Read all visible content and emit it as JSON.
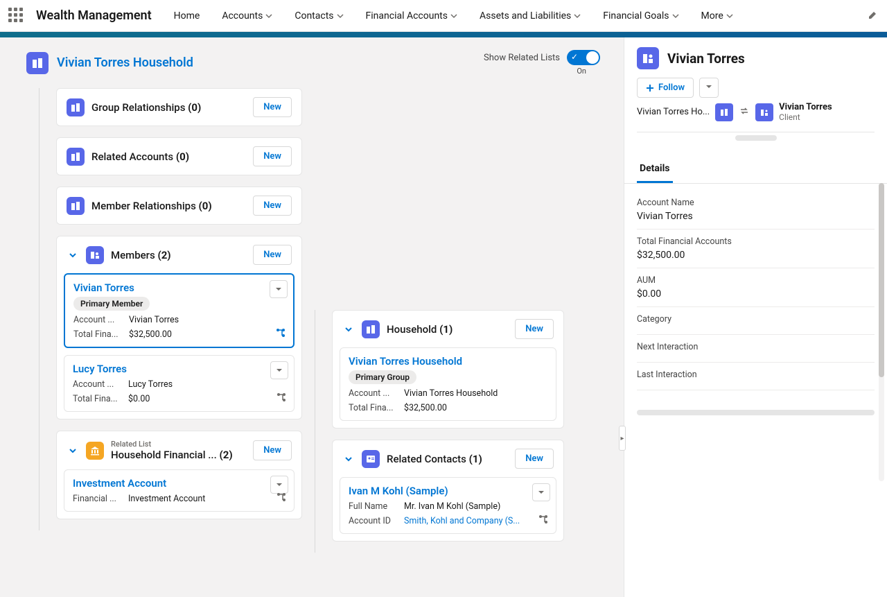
{
  "nav": {
    "appTitle": "Wealth Management",
    "items": [
      "Home",
      "Accounts",
      "Contacts",
      "Financial Accounts",
      "Assets and Liabilities",
      "Financial Goals",
      "More"
    ],
    "hasDropdown": [
      false,
      true,
      true,
      true,
      true,
      true,
      true
    ]
  },
  "page": {
    "title": "Vivian Torres Household",
    "toggleLabel": "Show Related Lists",
    "toggleState": "On"
  },
  "labels": {
    "new": "New",
    "follow": "Follow",
    "detailsTab": "Details"
  },
  "lists": {
    "groupRel": {
      "title": "Group Relationships",
      "count": "(0)"
    },
    "relAcc": {
      "title": "Related Accounts",
      "count": "(0)"
    },
    "memRel": {
      "title": "Member Relationships",
      "count": "(0)"
    },
    "members": {
      "title": "Members",
      "count": "(2)"
    },
    "hhFin": {
      "pretitle": "Related List",
      "title": "Household Financial ...",
      "count": "(2)"
    },
    "household": {
      "title": "Household",
      "count": "(1)"
    },
    "relCon": {
      "title": "Related Contacts",
      "count": "(1)"
    }
  },
  "members": [
    {
      "name": "Vivian Torres",
      "badge": "Primary Member",
      "fields": [
        {
          "k": "Account ...",
          "v": "Vivian Torres"
        },
        {
          "k": "Total Fina...",
          "v": "$32,500.00"
        }
      ],
      "selected": true,
      "shareColor": "blue"
    },
    {
      "name": "Lucy Torres",
      "fields": [
        {
          "k": "Account ...",
          "v": "Lucy Torres"
        },
        {
          "k": "Total Fina...",
          "v": "$0.00"
        }
      ],
      "selected": false,
      "shareColor": "gray"
    }
  ],
  "hhFinItems": [
    {
      "name": "Investment Account",
      "fields": [
        {
          "k": "Financial ...",
          "v": "Investment Account"
        }
      ],
      "shareColor": "gray"
    }
  ],
  "householdItems": [
    {
      "name": "Vivian Torres Household",
      "badge": "Primary Group",
      "fields": [
        {
          "k": "Account ...",
          "v": "Vivian Torres Household"
        },
        {
          "k": "Total Fina...",
          "v": "$32,500.00"
        }
      ]
    }
  ],
  "relatedContacts": [
    {
      "name": "Ivan M Kohl (Sample)",
      "fields": [
        {
          "k": "Full Name",
          "v": "Mr. Ivan M Kohl (Sample)",
          "link": false
        },
        {
          "k": "Account ID",
          "v": "Smith, Kohl and Company (S...",
          "link": true
        }
      ],
      "shareColor": "gray"
    }
  ],
  "sidebar": {
    "title": "Vivian Torres",
    "relation": {
      "leftTrunc": "Vivian Torres Ho...",
      "rightName": "Vivian Torres",
      "rightSub": "Client"
    },
    "details": [
      {
        "lbl": "Account Name",
        "val": "Vivian Torres"
      },
      {
        "lbl": "Total Financial Accounts",
        "val": "$32,500.00"
      },
      {
        "lbl": "AUM",
        "val": "$0.00"
      },
      {
        "lbl": "Category",
        "val": ""
      },
      {
        "lbl": "Next Interaction",
        "val": ""
      },
      {
        "lbl": "Last Interaction",
        "val": ""
      }
    ]
  }
}
